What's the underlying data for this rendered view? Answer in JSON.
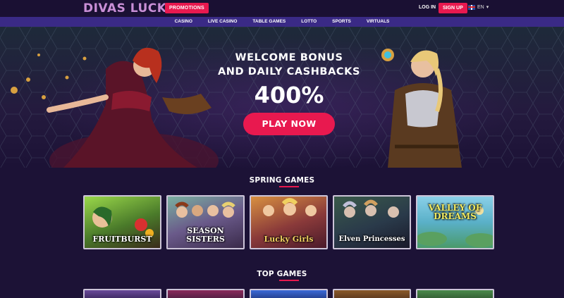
{
  "header": {
    "logo": "DIVAS LUCK",
    "promotions_label": "PROMOTIONS",
    "login_label": "LOG IN",
    "signup_label": "SIGN UP",
    "language": "EN"
  },
  "nav": {
    "items": [
      {
        "label": "CASINO"
      },
      {
        "label": "LIVE CASINO"
      },
      {
        "label": "TABLE GAMES"
      },
      {
        "label": "LOTTO"
      },
      {
        "label": "SPORTS"
      },
      {
        "label": "VIRTUALS"
      }
    ]
  },
  "hero": {
    "line1": "WELCOME BONUS",
    "line2": "AND DAILY CASHBACKS",
    "percent": "400%",
    "cta_label": "PLAY NOW"
  },
  "spring_games": {
    "title": "SPRING GAMES",
    "games": [
      {
        "name": "FRUITBURST",
        "color": "#5a8a3a"
      },
      {
        "name": "SEASON SISTERS",
        "color": "#6a5a8a"
      },
      {
        "name": "Lucky Girls",
        "color": "#8a3a3a"
      },
      {
        "name": "Elven Princesses",
        "color": "#2a4a5a"
      },
      {
        "name": "VALLEY OF DREAMS",
        "color": "#5ab0c8"
      }
    ]
  },
  "top_games": {
    "title": "TOP GAMES"
  },
  "colors": {
    "accent": "#e8194f",
    "nav": "#3a2a86",
    "background": "#1c1236"
  }
}
